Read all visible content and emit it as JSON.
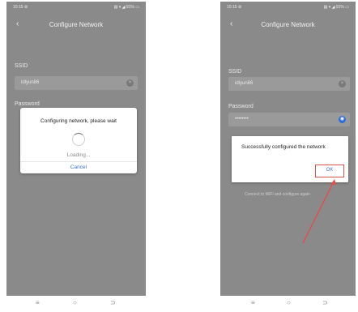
{
  "left_screen": {
    "status_time": "10:15 ⚙",
    "status_icons": "▤ ▾ ◢ 91% ▭",
    "title": "Configure Network",
    "ssid_label": "SSID",
    "ssid_value": "idlyun86",
    "password_label": "Password",
    "dialog_message": "Configuring network, please wait",
    "loading_text": "Loading...",
    "cancel_label": "Cancel"
  },
  "right_screen": {
    "status_time": "10:15 ⚙",
    "status_icons": "▤ ▾ ◢ 91% ▭",
    "title": "Configure Network",
    "ssid_label": "SSID",
    "ssid_value": "idlyun86",
    "password_label": "Password",
    "password_value": "••••••••",
    "dialog_message": "Successfully configured the network",
    "ok_label": "OK",
    "hint_text": "Connect to WiFi and configure again"
  },
  "bottom_nav": {
    "menu_icon": "≡",
    "home_icon": "○",
    "back_icon": "⊃"
  },
  "colors": {
    "highlight": "#d9534f",
    "accent": "#2f6fd6"
  }
}
